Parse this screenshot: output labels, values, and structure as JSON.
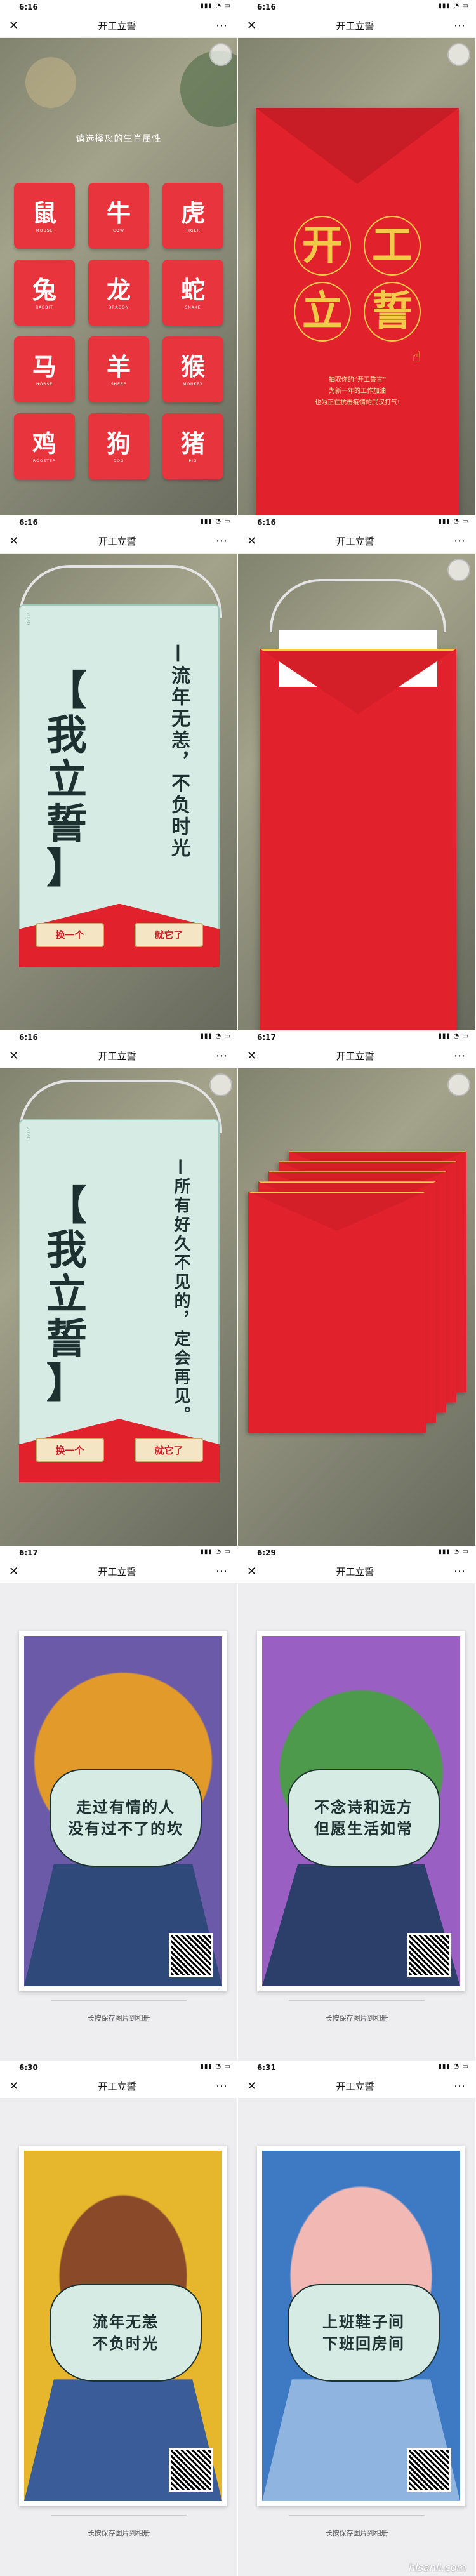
{
  "screens": [
    {
      "time": "6:16",
      "title": "开工立誓"
    },
    {
      "time": "6:16",
      "title": "开工立誓"
    },
    {
      "time": "6:16",
      "title": "开工立誓"
    },
    {
      "time": "6:16",
      "title": "开工立誓"
    },
    {
      "time": "6:16",
      "title": "开工立誓"
    },
    {
      "time": "6:17",
      "title": "开工立誓"
    },
    {
      "time": "6:17",
      "title": "开工立誓"
    },
    {
      "time": "6:29",
      "title": "开工立誓"
    },
    {
      "time": "6:30",
      "title": "开工立誓"
    },
    {
      "time": "6:31",
      "title": "开工立誓"
    }
  ],
  "zodiac": {
    "prompt": "请选择您的生肖属性",
    "items": [
      {
        "ch": "鼠",
        "en": "MOUSE"
      },
      {
        "ch": "牛",
        "en": "COW"
      },
      {
        "ch": "虎",
        "en": "TIGER"
      },
      {
        "ch": "兔",
        "en": "RABBIT"
      },
      {
        "ch": "龙",
        "en": "DRAGON"
      },
      {
        "ch": "蛇",
        "en": "SNAKE"
      },
      {
        "ch": "马",
        "en": "HORSE"
      },
      {
        "ch": "羊",
        "en": "SHEEP"
      },
      {
        "ch": "猴",
        "en": "MONKEY"
      },
      {
        "ch": "鸡",
        "en": "ROOSTER"
      },
      {
        "ch": "狗",
        "en": "DOG"
      },
      {
        "ch": "猪",
        "en": "PIG"
      }
    ]
  },
  "envelope": {
    "title_chars": [
      "开",
      "工",
      "立",
      "誓"
    ],
    "line1": "抽取你的“开工誓言”",
    "line2": "为新一年的工作加油",
    "line3": "也为正在抗击疫情的武汉打气!"
  },
  "vow1": {
    "year": "2020",
    "bracket_text": [
      "【",
      "我",
      "立",
      "誓",
      "】"
    ],
    "quote": "—流年无恙，不负时光",
    "btn_change": "换一个",
    "btn_confirm": "就它了"
  },
  "vow2": {
    "year": "2020",
    "bracket_text": [
      "【",
      "我",
      "立",
      "誓",
      "】"
    ],
    "quote": "—所有好久不见的，定会再见。",
    "btn_change": "换一个",
    "btn_confirm": "就它了"
  },
  "posters": [
    {
      "lines": [
        "走过有情的人",
        "没有过不了的坎"
      ]
    },
    {
      "lines": [
        "不念诗和远方",
        "但愿生活如常"
      ]
    },
    {
      "lines": [
        "流年无恙",
        "不负时光"
      ]
    },
    {
      "lines": [
        "上班鞋子间",
        "下班回房间"
      ]
    }
  ],
  "save_hint": "长按保存图片到相册",
  "watermark": "hisanli.com",
  "colors": {
    "red": "#e1222d",
    "gold": "#f3c94a",
    "mint": "#d7ebe5",
    "ink": "#1c3130"
  },
  "icons": [
    "close-icon",
    "more-icon"
  ]
}
